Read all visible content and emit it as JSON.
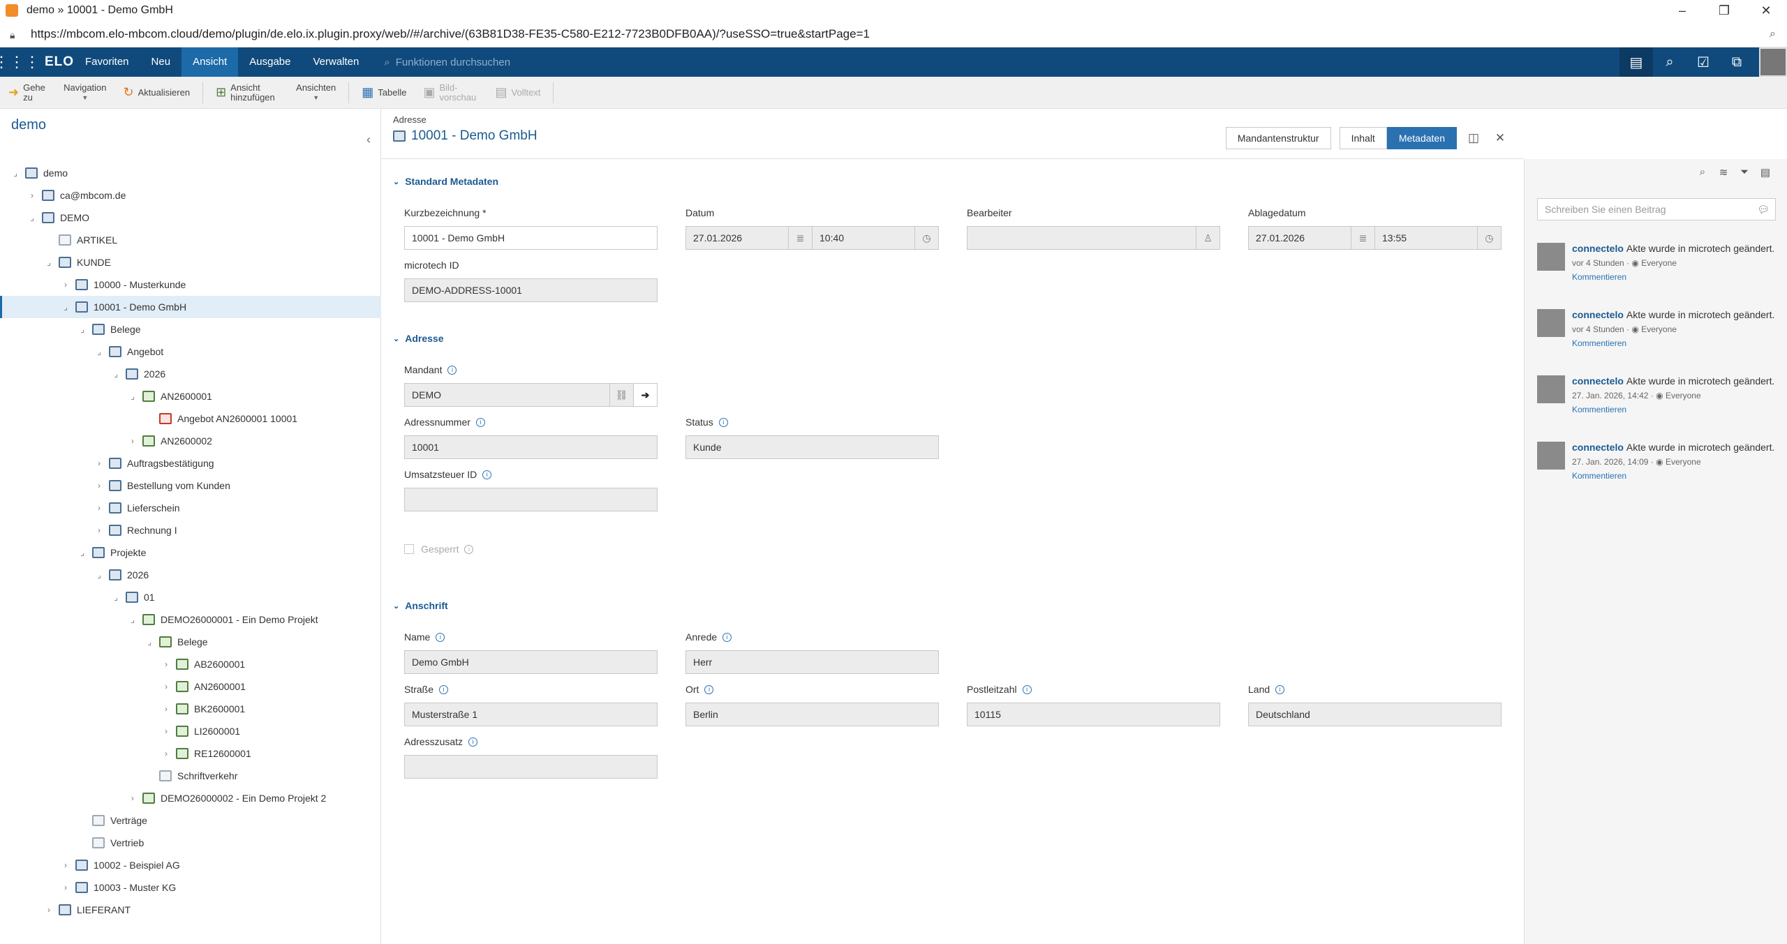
{
  "browser": {
    "tab_title": "demo » 10001 - Demo GmbH",
    "url": "https://mbcom.elo-mbcom.cloud/demo/plugin/de.elo.ix.plugin.proxy/web//#/archive/(63B81D38-FE35-C580-E212-7723B0DFB0AA)/?useSSO=true&startPage=1"
  },
  "app": {
    "logo": "ELO",
    "menu": [
      "Favoriten",
      "Neu",
      "Ansicht",
      "Ausgabe",
      "Verwalten"
    ],
    "active_menu": "Ansicht",
    "search_placeholder": "Funktionen durchsuchen"
  },
  "toolbar": {
    "goto": "Gehe zu",
    "navigation": "Navigation",
    "refresh": "Aktualisieren",
    "add_view": "Ansicht hinzufügen",
    "views": "Ansichten",
    "table": "Tabelle",
    "preview": "Bild-vorschau",
    "fulltext": "Volltext"
  },
  "tree": {
    "title": "demo",
    "items": [
      {
        "label": "demo",
        "level": 0,
        "expander": "⌟",
        "icon": "repo"
      },
      {
        "label": "ca@mbcom.de",
        "level": 1,
        "expander": "›",
        "icon": "folder"
      },
      {
        "label": "DEMO",
        "level": 1,
        "expander": "⌟",
        "icon": "folder"
      },
      {
        "label": "ARTIKEL",
        "level": 2,
        "expander": "",
        "icon": "plain"
      },
      {
        "label": "KUNDE",
        "level": 2,
        "expander": "⌟",
        "icon": "folder"
      },
      {
        "label": "10000 - Musterkunde",
        "level": 3,
        "expander": "›",
        "icon": "folder"
      },
      {
        "label": "10001 - Demo GmbH",
        "level": 3,
        "expander": "⌟",
        "icon": "folder",
        "selected": true
      },
      {
        "label": "Belege",
        "level": 4,
        "expander": "⌟",
        "icon": "folder"
      },
      {
        "label": "Angebot",
        "level": 5,
        "expander": "⌟",
        "icon": "folder"
      },
      {
        "label": "2026",
        "level": 6,
        "expander": "⌟",
        "icon": "folder"
      },
      {
        "label": "AN2600001",
        "level": 7,
        "expander": "⌟",
        "icon": "green"
      },
      {
        "label": "Angebot AN2600001 10001",
        "level": 8,
        "expander": "",
        "icon": "doc"
      },
      {
        "label": "AN2600002",
        "level": 7,
        "expander": "›",
        "icon": "green"
      },
      {
        "label": "Auftragsbestätigung",
        "level": 5,
        "expander": "›",
        "icon": "folder"
      },
      {
        "label": "Bestellung vom Kunden",
        "level": 5,
        "expander": "›",
        "icon": "folder"
      },
      {
        "label": "Lieferschein",
        "level": 5,
        "expander": "›",
        "icon": "folder"
      },
      {
        "label": "Rechnung I",
        "level": 5,
        "expander": "›",
        "icon": "folder"
      },
      {
        "label": "Projekte",
        "level": 4,
        "expander": "⌟",
        "icon": "folder"
      },
      {
        "label": "2026",
        "level": 5,
        "expander": "⌟",
        "icon": "folder"
      },
      {
        "label": "01",
        "level": 6,
        "expander": "⌟",
        "icon": "folder"
      },
      {
        "label": "DEMO26000001 - Ein Demo Projekt",
        "level": 7,
        "expander": "⌟",
        "icon": "green"
      },
      {
        "label": "Belege",
        "level": 8,
        "expander": "⌟",
        "icon": "green"
      },
      {
        "label": "AB2600001",
        "level": 9,
        "expander": "›",
        "icon": "green"
      },
      {
        "label": "AN2600001",
        "level": 9,
        "expander": "›",
        "icon": "green"
      },
      {
        "label": "BK2600001",
        "level": 9,
        "expander": "›",
        "icon": "green"
      },
      {
        "label": "LI2600001",
        "level": 9,
        "expander": "›",
        "icon": "green"
      },
      {
        "label": "RE12600001",
        "level": 9,
        "expander": "›",
        "icon": "green"
      },
      {
        "label": "Schriftverkehr",
        "level": 8,
        "expander": "",
        "icon": "plain"
      },
      {
        "label": "DEMO26000002 - Ein Demo Projekt 2",
        "level": 7,
        "expander": "›",
        "icon": "green"
      },
      {
        "label": "Verträge",
        "level": 4,
        "expander": "",
        "icon": "plain"
      },
      {
        "label": "Vertrieb",
        "level": 4,
        "expander": "",
        "icon": "plain"
      },
      {
        "label": "10002 - Beispiel AG",
        "level": 3,
        "expander": "›",
        "icon": "folder"
      },
      {
        "label": "10003 - Muster KG",
        "level": 3,
        "expander": "›",
        "icon": "folder"
      },
      {
        "label": "LIEFERANT",
        "level": 2,
        "expander": "›",
        "icon": "folder"
      }
    ]
  },
  "header": {
    "breadcrumb": "Adresse",
    "title": "10001 - Demo GmbH",
    "btn_mandant": "Mandantenstruktur",
    "btn_inhalt": "Inhalt",
    "btn_metadaten": "Metadaten"
  },
  "form": {
    "sec_standard": "Standard Metadaten",
    "kurz_label": "Kurzbezeichnung *",
    "kurz_value": "10001 - Demo GmbH",
    "datum_label": "Datum",
    "datum_date": "27.01.2026",
    "datum_time": "10:40",
    "bearbeiter_label": "Bearbeiter",
    "bearbeiter_value": "",
    "ablage_label": "Ablagedatum",
    "ablage_date": "27.01.2026",
    "ablage_time": "13:55",
    "microtech_label": "microtech ID",
    "microtech_value": "DEMO-ADDRESS-10001",
    "sec_adresse": "Adresse",
    "mandant_label": "Mandant",
    "mandant_value": "DEMO",
    "adressnr_label": "Adressnummer",
    "adressnr_value": "10001",
    "status_label": "Status",
    "status_value": "Kunde",
    "ust_label": "Umsatzsteuer ID",
    "ust_value": "",
    "gesperrt_label": "Gesperrt",
    "sec_anschrift": "Anschrift",
    "name_label": "Name",
    "name_value": "Demo GmbH",
    "anrede_label": "Anrede",
    "anrede_value": "Herr",
    "strasse_label": "Straße",
    "strasse_value": "Musterstraße 1",
    "ort_label": "Ort",
    "ort_value": "Berlin",
    "plz_label": "Postleitzahl",
    "plz_value": "10115",
    "land_label": "Land",
    "land_value": "Deutschland",
    "zusatz_label": "Adresszusatz",
    "zusatz_value": ""
  },
  "feed": {
    "placeholder": "Schreiben Sie einen Beitrag",
    "posts": [
      {
        "user": "connectelo",
        "text": "Akte wurde in microtech geändert.",
        "time": "vor 4 Stunden",
        "audience": "Everyone",
        "action": "Kommentieren"
      },
      {
        "user": "connectelo",
        "text": "Akte wurde in microtech geändert.",
        "time": "vor 4 Stunden",
        "audience": "Everyone",
        "action": "Kommentieren"
      },
      {
        "user": "connectelo",
        "text": "Akte wurde in microtech geändert.",
        "time": "27. Jan. 2026, 14:42",
        "audience": "Everyone",
        "action": "Kommentieren"
      },
      {
        "user": "connectelo",
        "text": "Akte wurde in microtech geändert.",
        "time": "27. Jan. 2026, 14:09",
        "audience": "Everyone",
        "action": "Kommentieren"
      }
    ]
  }
}
